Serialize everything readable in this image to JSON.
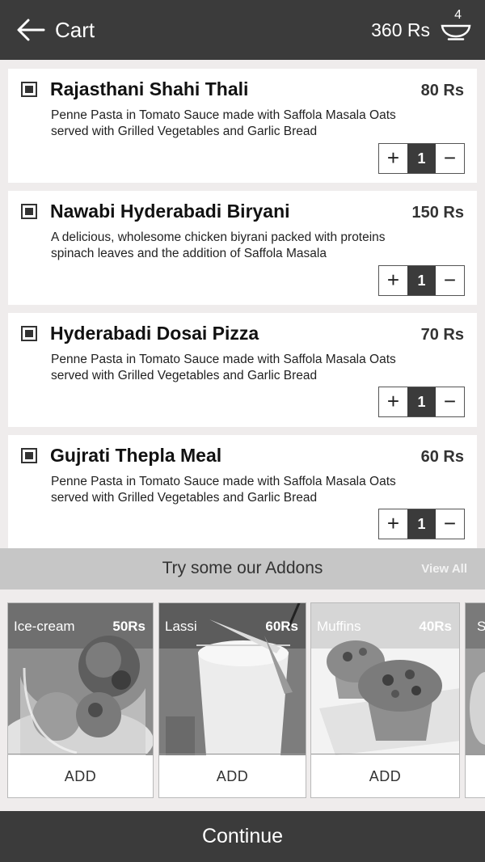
{
  "header": {
    "title": "Cart",
    "total": "360 Rs",
    "cart_count": "4",
    "back_icon": "arrow-left-icon",
    "cart_icon": "bowl-icon"
  },
  "cart": {
    "items": [
      {
        "name": "Rajasthani Shahi Thali",
        "price": "80 Rs",
        "description": "Penne Pasta in Tomato Sauce made with Saffola Masala Oats served with Grilled Vegetables and Garlic Bread",
        "quantity": "1"
      },
      {
        "name": "Nawabi Hyderabadi Biryani",
        "price": "150 Rs",
        "description": "A delicious, wholesome chicken biyrani packed with proteins spinach leaves and the addition of Saffola Masala",
        "quantity": "1"
      },
      {
        "name": "Hyderabadi Dosai Pizza",
        "price": "70 Rs",
        "description": "Penne Pasta in Tomato Sauce made with Saffola Masala Oats served with Grilled Vegetables and Garlic Bread",
        "quantity": "1"
      },
      {
        "name": "Gujrati Thepla Meal",
        "price": "60 Rs",
        "description": "Penne Pasta in Tomato Sauce made with Saffola Masala Oats served with Grilled Vegetables and Garlic Bread",
        "quantity": "1"
      }
    ],
    "plus_symbol": "+",
    "minus_symbol": "−"
  },
  "addons": {
    "title": "Try some our Addons",
    "view_all": "View All",
    "items": [
      {
        "name": "Ice-cream",
        "price": "50Rs",
        "add_label": "ADD"
      },
      {
        "name": "Lassi",
        "price": "60Rs",
        "add_label": "ADD"
      },
      {
        "name": "Muffins",
        "price": "40Rs",
        "add_label": "ADD"
      },
      {
        "name": "S",
        "price": "",
        "add_label": ""
      }
    ]
  },
  "footer": {
    "continue_label": "Continue"
  },
  "colors": {
    "header_bg": "#3b3b3b",
    "page_bg": "#efecec",
    "addons_bar_bg": "#c6c6c6"
  }
}
